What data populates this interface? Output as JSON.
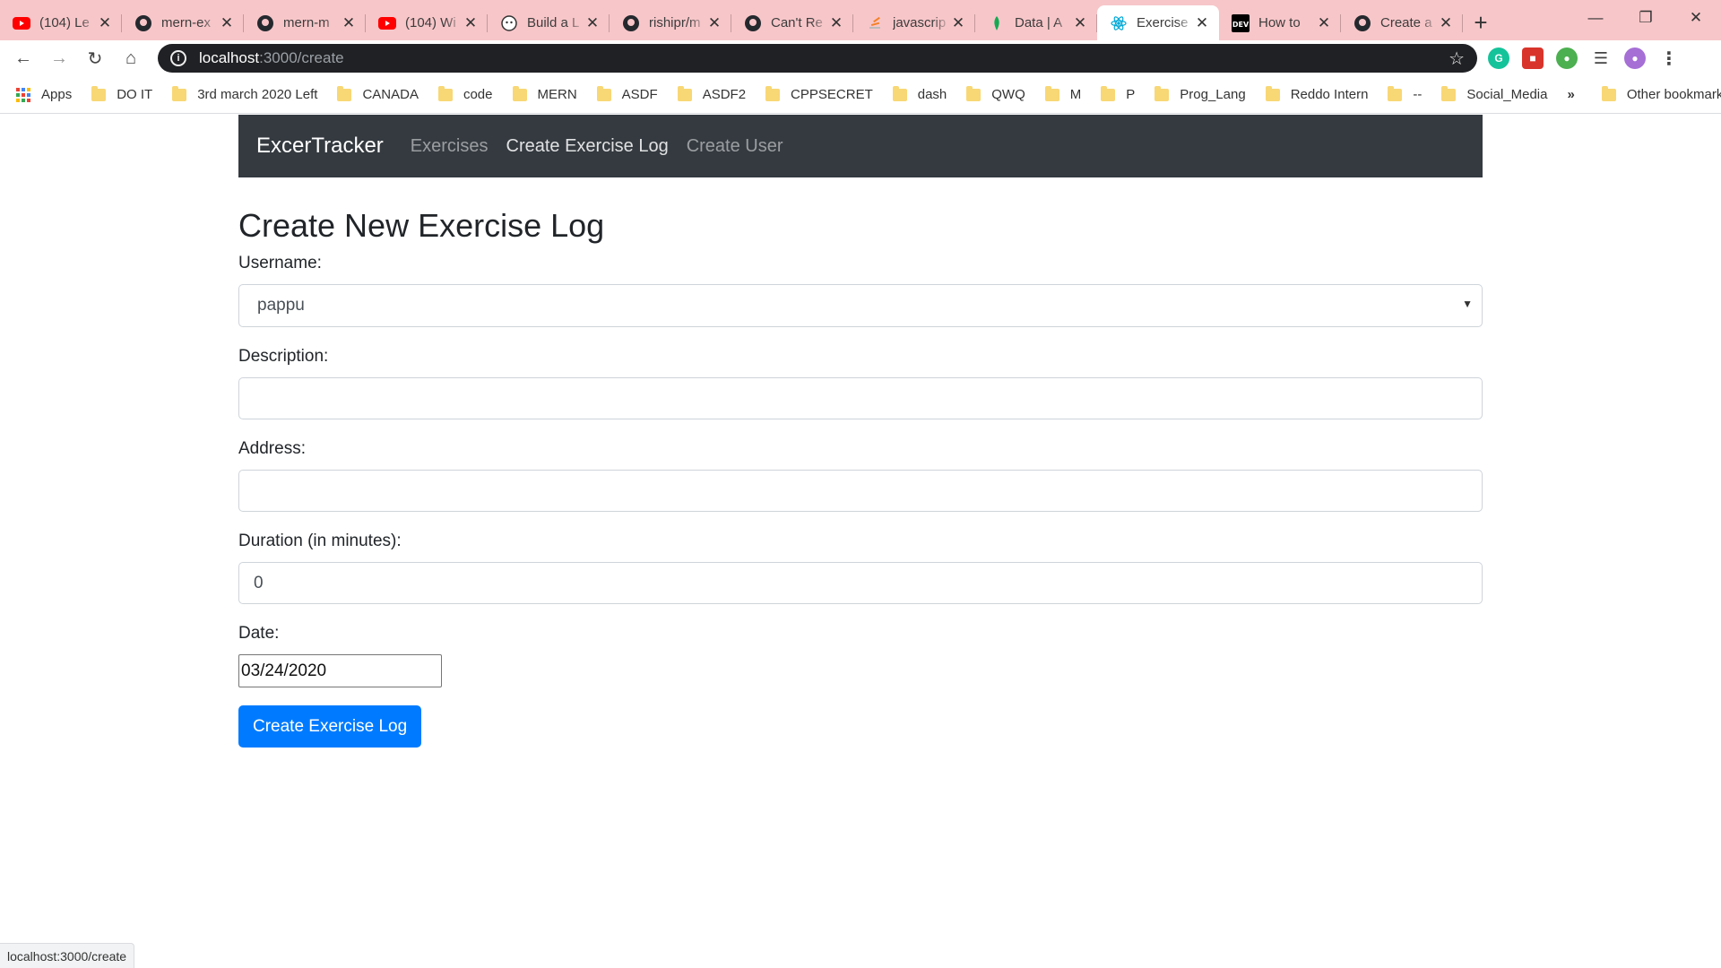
{
  "browser": {
    "tabs": [
      {
        "title": "(104) Le",
        "icon": "youtube-icon",
        "active": false
      },
      {
        "title": "mern-ex",
        "icon": "github-icon",
        "active": false
      },
      {
        "title": "mern-m",
        "icon": "github-icon",
        "active": false
      },
      {
        "title": "(104) Wi",
        "icon": "youtube-icon",
        "active": false
      },
      {
        "title": "Build a L",
        "icon": "build-site-icon",
        "active": false
      },
      {
        "title": "rishipr/m",
        "icon": "github-icon",
        "active": false
      },
      {
        "title": "Can't Re",
        "icon": "github-icon",
        "active": false
      },
      {
        "title": "javascrip",
        "icon": "stackoverflow-icon",
        "active": false
      },
      {
        "title": "Data | A",
        "icon": "mongodb-icon",
        "active": false
      },
      {
        "title": "Exercise",
        "icon": "react-icon",
        "active": true
      },
      {
        "title": "How to",
        "icon": "dev-icon",
        "active": false
      },
      {
        "title": "Create a",
        "icon": "github-icon",
        "active": false
      }
    ],
    "new_tab_label": "+",
    "address": {
      "host": "localhost",
      "path": ":3000/create"
    },
    "bookmarks": [
      {
        "label": "DO IT"
      },
      {
        "label": "3rd march 2020 Left"
      },
      {
        "label": "CANADA"
      },
      {
        "label": "code"
      },
      {
        "label": "MERN"
      },
      {
        "label": "ASDF"
      },
      {
        "label": "ASDF2"
      },
      {
        "label": "CPPSECRET"
      },
      {
        "label": "dash"
      },
      {
        "label": "QWQ"
      },
      {
        "label": "M"
      },
      {
        "label": "P"
      },
      {
        "label": "Prog_Lang"
      },
      {
        "label": "Reddo Intern"
      },
      {
        "label": "--"
      },
      {
        "label": "Social_Media"
      }
    ],
    "apps_label": "Apps",
    "other_bookmarks_label": "Other bookmarks",
    "overflow_label": "»",
    "status_url": "localhost:3000/create"
  },
  "navbar": {
    "brand": "ExcerTracker",
    "links": [
      "Exercises",
      "Create Exercise Log",
      "Create User"
    ],
    "active_index": 1
  },
  "form": {
    "heading": "Create New Exercise Log",
    "username_label": "Username:",
    "username_value": "pappu",
    "description_label": "Description:",
    "description_value": "",
    "address_label": "Address:",
    "address_value": "",
    "duration_label": "Duration (in minutes):",
    "duration_value": "0",
    "date_label": "Date:",
    "date_value": "03/24/2020",
    "submit_label": "Create Exercise Log"
  },
  "colors": {
    "tabbar": "#f7c6c9",
    "navbar": "#343a40",
    "primary": "#007bff"
  }
}
